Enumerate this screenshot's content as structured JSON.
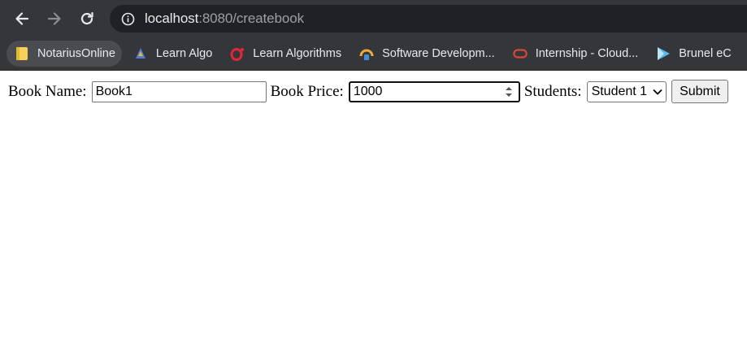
{
  "browser": {
    "url_host": "localhost",
    "url_rest": ":8080/createbook",
    "bookmarks": [
      {
        "label": "NotariusOnline",
        "icon": "folder-icon"
      },
      {
        "label": "Learn Algo",
        "icon": "algo-icon"
      },
      {
        "label": "Learn Algorithms",
        "icon": "opera-icon"
      },
      {
        "label": "Software Developm...",
        "icon": "dev-icon"
      },
      {
        "label": "Internship - Cloud...",
        "icon": "oracle-icon"
      },
      {
        "label": "Brunel eC",
        "icon": "play-icon"
      }
    ]
  },
  "form": {
    "book_name_label": "Book Name:",
    "book_name_value": "Book1",
    "book_price_label": "Book Price:",
    "book_price_value": "1000",
    "students_label": "Students:",
    "students_selected": "Student 1",
    "submit_label": "Submit"
  }
}
